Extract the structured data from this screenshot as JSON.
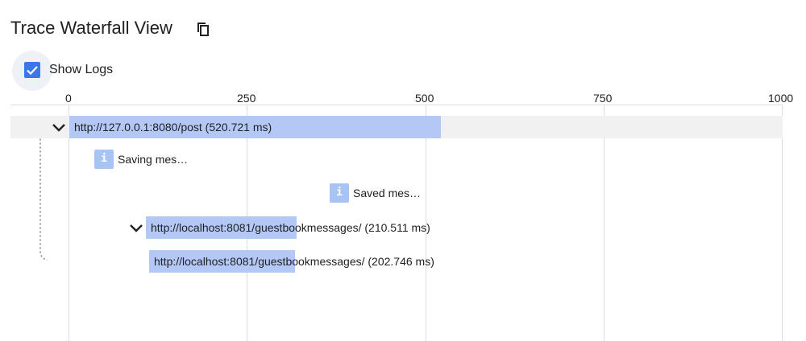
{
  "header": {
    "title": "Trace Waterfall View",
    "copy_icon": "copy-icon"
  },
  "options": {
    "show_logs_label": "Show Logs",
    "show_logs_checked": true
  },
  "axis": {
    "ticks": [
      "0",
      "250",
      "500",
      "750",
      "1000"
    ]
  },
  "spans": [
    {
      "label": "http://127.0.0.1:8080/post (520.721 ms)",
      "expanded": true
    },
    {
      "label": "http://localhost:8081/guestbookmessages/ (210.511 ms)",
      "expanded": true
    },
    {
      "label": "http://localhost:8081/guestbookmessages/ (202.746 ms)"
    }
  ],
  "logs": [
    {
      "icon": "i",
      "label": "Saving mes…"
    },
    {
      "icon": "i",
      "label": "Saved mes…"
    }
  ],
  "colors": {
    "bar": "#b3c8f5",
    "log_badge": "#a8c4f4",
    "checkbox": "#3b78e7",
    "grid": "#dadce0"
  }
}
